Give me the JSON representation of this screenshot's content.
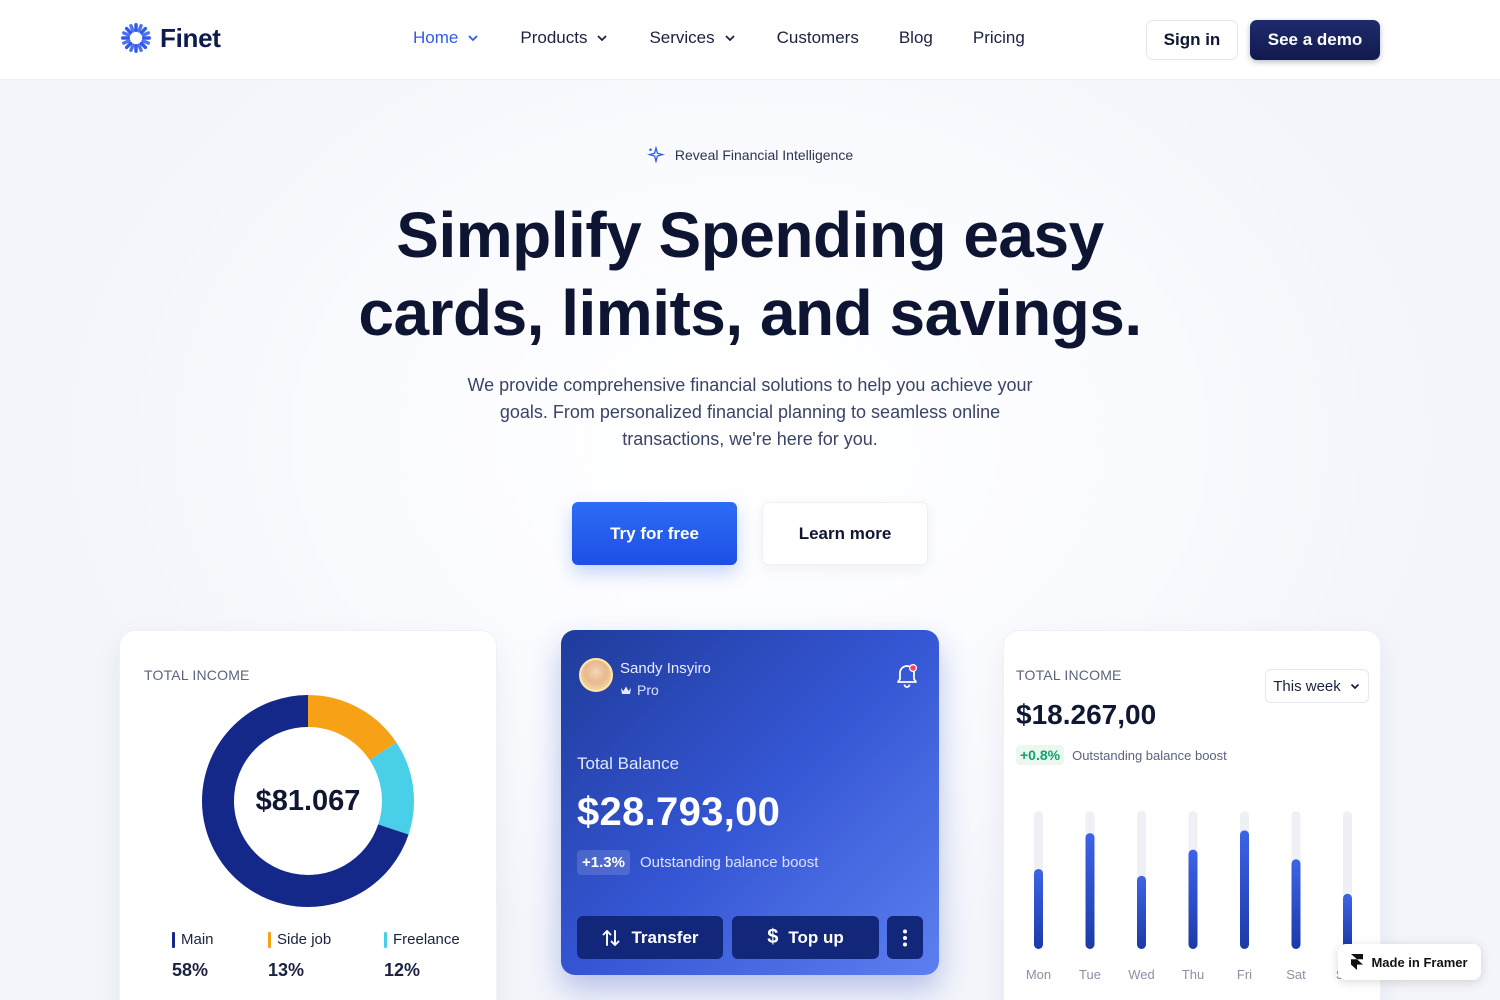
{
  "brand": {
    "name": "Finet",
    "accent": "#2f5bea",
    "navy": "#111a4d"
  },
  "nav": {
    "items": [
      {
        "label": "Home",
        "dropdown": true,
        "active": true
      },
      {
        "label": "Products",
        "dropdown": true,
        "active": false
      },
      {
        "label": "Services",
        "dropdown": true,
        "active": false
      },
      {
        "label": "Customers",
        "dropdown": false,
        "active": false
      },
      {
        "label": "Blog",
        "dropdown": false,
        "active": false
      },
      {
        "label": "Pricing",
        "dropdown": false,
        "active": false
      }
    ],
    "signin_label": "Sign in",
    "demo_label": "See a demo"
  },
  "hero": {
    "eyebrow": "Reveal Financial Intelligence",
    "title_line1": "Simplify Spending easy",
    "title_line2": "cards, limits, and savings.",
    "subtitle": "We provide comprehensive financial solutions to help you achieve your goals. From personalized financial planning to seamless online transactions, we're here for you.",
    "try_label": "Try for free",
    "learn_label": "Learn more"
  },
  "income_card": {
    "label": "TOTAL INCOME",
    "total": "$81.067",
    "segments": [
      {
        "name": "Main",
        "value": "58%",
        "color": "#14288a"
      },
      {
        "name": "Side job",
        "value": "13%",
        "color": "#f7a116"
      },
      {
        "name": "Freelance",
        "value": "12%",
        "color": "#49cfe8"
      }
    ]
  },
  "balance_card": {
    "user_name": "Sandy Insyiro",
    "user_tier": "Pro",
    "label": "Total Balance",
    "value": "$28.793,00",
    "delta": "+1.3%",
    "delta_text": "Outstanding balance boost",
    "transfer_label": "Transfer",
    "topup_label": "Top up"
  },
  "weekly_card": {
    "label": "TOTAL INCOME",
    "period": "This week",
    "value": "$18.267,00",
    "delta": "+0.8%",
    "delta_text": "Outstanding balance boost",
    "days": [
      "Mon",
      "Tue",
      "Wed",
      "Thu",
      "Fri",
      "Sat",
      "Sun"
    ],
    "levels": [
      0.58,
      0.84,
      0.53,
      0.72,
      0.86,
      0.65,
      0.4
    ]
  },
  "badge": {
    "label": "Made in Framer"
  }
}
